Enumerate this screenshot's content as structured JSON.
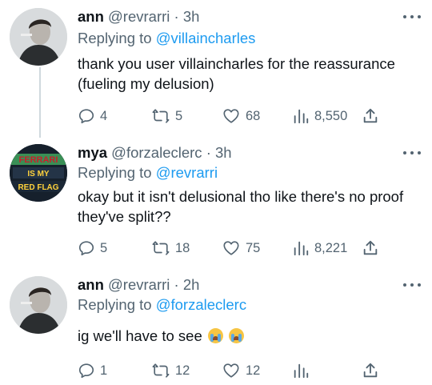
{
  "tweets": [
    {
      "name": "ann",
      "handle": "@revrarri",
      "time": "3h",
      "replying_prefix": "Replying to",
      "replying_to": "@villaincharles",
      "text": "thank you user villaincharles for the reassurance (fueling my delusion)",
      "replies": "4",
      "retweets": "5",
      "likes": "68",
      "views": "8,550"
    },
    {
      "name": "mya",
      "handle": "@forzaleclerc",
      "time": "3h",
      "replying_prefix": "Replying to",
      "replying_to": "@revrarri",
      "text": "okay but it isn't delusional tho like there's no proof they've split??",
      "replies": "5",
      "retweets": "18",
      "likes": "75",
      "views": "8,221",
      "avatar_sign_lines": [
        "FERRARI",
        "IS MY",
        "RED FLAG"
      ]
    },
    {
      "name": "ann",
      "handle": "@revrarri",
      "time": "2h",
      "replying_prefix": "Replying to",
      "replying_to": "@forzaleclerc",
      "text": "ig we'll have to see",
      "replies": "1",
      "retweets": "12",
      "likes": "12",
      "views": ""
    }
  ],
  "separator": "·",
  "icons": [
    "reply-icon",
    "retweet-icon",
    "like-icon",
    "views-icon",
    "share-icon",
    "more-icon",
    "loudly-crying-face-emoji"
  ],
  "colors": {
    "text": "#0f1419",
    "secondary": "#536471",
    "link": "#1d9bf0",
    "thread_line": "#cfd9de"
  }
}
